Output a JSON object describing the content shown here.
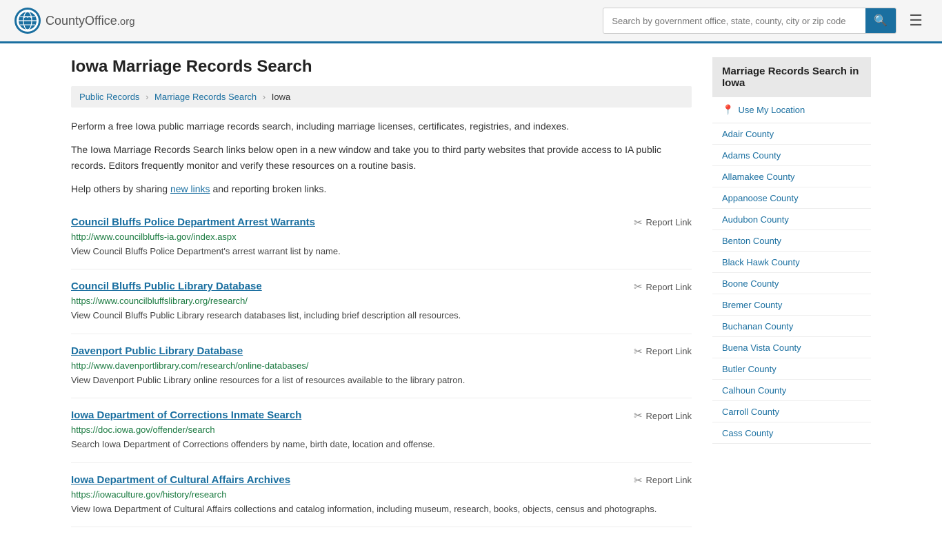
{
  "header": {
    "logo_text": "CountyOffice",
    "logo_suffix": ".org",
    "search_placeholder": "Search by government office, state, county, city or zip code",
    "search_btn_label": "🔍"
  },
  "breadcrumb": {
    "items": [
      {
        "label": "Public Records",
        "href": "#"
      },
      {
        "label": "Marriage Records Search",
        "href": "#"
      },
      {
        "label": "Iowa",
        "href": null
      }
    ]
  },
  "page": {
    "title": "Iowa Marriage Records Search",
    "intro1": "Perform a free Iowa public marriage records search, including marriage licenses, certificates, registries, and indexes.",
    "intro2": "The Iowa Marriage Records Search links below open in a new window and take you to third party websites that provide access to IA public records. Editors frequently monitor and verify these resources on a routine basis.",
    "intro3_prefix": "Help others by sharing ",
    "intro3_link": "new links",
    "intro3_suffix": " and reporting broken links."
  },
  "records": [
    {
      "title": "Council Bluffs Police Department Arrest Warrants",
      "url": "http://www.councilbluffs-ia.gov/index.aspx",
      "desc": "View Council Bluffs Police Department's arrest warrant list by name."
    },
    {
      "title": "Council Bluffs Public Library Database",
      "url": "https://www.councilbluffslibrary.org/research/",
      "desc": "View Council Bluffs Public Library research databases list, including brief description all resources."
    },
    {
      "title": "Davenport Public Library Database",
      "url": "http://www.davenportlibrary.com/research/online-databases/",
      "desc": "View Davenport Public Library online resources for a list of resources available to the library patron."
    },
    {
      "title": "Iowa Department of Corrections Inmate Search",
      "url": "https://doc.iowa.gov/offender/search",
      "desc": "Search Iowa Department of Corrections offenders by name, birth date, location and offense."
    },
    {
      "title": "Iowa Department of Cultural Affairs Archives",
      "url": "https://iowaculture.gov/history/research",
      "desc": "View Iowa Department of Cultural Affairs collections and catalog information, including museum, research, books, objects, census and photographs."
    }
  ],
  "report_label": "Report Link",
  "sidebar": {
    "title": "Marriage Records Search in Iowa",
    "location_label": "Use My Location",
    "counties": [
      "Adair County",
      "Adams County",
      "Allamakee County",
      "Appanoose County",
      "Audubon County",
      "Benton County",
      "Black Hawk County",
      "Boone County",
      "Bremer County",
      "Buchanan County",
      "Buena Vista County",
      "Butler County",
      "Calhoun County",
      "Carroll County",
      "Cass County"
    ]
  }
}
